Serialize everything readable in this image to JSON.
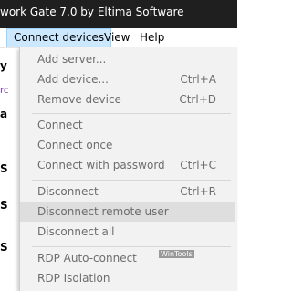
{
  "window": {
    "title": "work Gate 7.0 by Eltima Software"
  },
  "menubar": {
    "items": [
      "Connect devices",
      "View",
      "Help"
    ]
  },
  "background": {
    "fragments": [
      "y",
      "rc",
      "a",
      "S",
      "S",
      "S"
    ]
  },
  "dropdown": {
    "items": [
      {
        "label": "Add server...",
        "shortcut": ""
      },
      {
        "label": "Add device...",
        "shortcut": "Ctrl+A"
      },
      {
        "label": "Remove device",
        "shortcut": "Ctrl+D"
      },
      {
        "label": "Connect",
        "shortcut": ""
      },
      {
        "label": "Connect once",
        "shortcut": ""
      },
      {
        "label": "Connect with password",
        "shortcut": "Ctrl+C"
      },
      {
        "label": "Disconnect",
        "shortcut": "Ctrl+R"
      },
      {
        "label": "Disconnect remote user",
        "shortcut": ""
      },
      {
        "label": "Disconnect all",
        "shortcut": ""
      },
      {
        "label": "RDP Auto-connect",
        "shortcut": ""
      },
      {
        "label": "RDP Isolation",
        "shortcut": ""
      }
    ]
  },
  "watermark": {
    "text": "WinTools"
  },
  "colors": {
    "titlebar": "#1f1f1f",
    "menu_active": "#cce8ff",
    "dropdown_bg": "#f2f2f2",
    "highlight": "#dedede",
    "text_disabled": "#6d6d6d"
  }
}
